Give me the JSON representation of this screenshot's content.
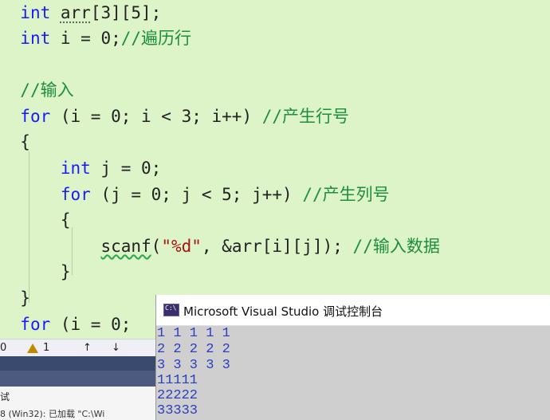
{
  "editor": {
    "lines": [
      {
        "indent": "  ",
        "parts": [
          {
            "t": "int",
            "c": "kw"
          },
          {
            "t": " ",
            "c": "id"
          },
          {
            "t": "arr",
            "c": "var dotted"
          },
          {
            "t": "[3][5];",
            "c": "id"
          }
        ]
      },
      {
        "indent": "  ",
        "parts": [
          {
            "t": "int",
            "c": "kw"
          },
          {
            "t": " i = 0;",
            "c": "id"
          },
          {
            "t": "//遍历行",
            "c": "cm"
          }
        ]
      },
      {
        "indent": "",
        "parts": []
      },
      {
        "indent": "  ",
        "parts": [
          {
            "t": "//输入",
            "c": "cm"
          }
        ]
      },
      {
        "indent": "  ",
        "parts": [
          {
            "t": "for",
            "c": "kw"
          },
          {
            "t": " (i = 0; i < 3; i++) ",
            "c": "id"
          },
          {
            "t": "//产生行号",
            "c": "cm"
          }
        ]
      },
      {
        "indent": "  ",
        "parts": [
          {
            "t": "{",
            "c": "id"
          }
        ]
      },
      {
        "indent": "      ",
        "parts": [
          {
            "t": "int",
            "c": "kw"
          },
          {
            "t": " j = 0;",
            "c": "id"
          }
        ]
      },
      {
        "indent": "      ",
        "parts": [
          {
            "t": "for",
            "c": "kw"
          },
          {
            "t": " (j = 0; j < 5; j++) ",
            "c": "id"
          },
          {
            "t": "//产生列号",
            "c": "cm"
          }
        ]
      },
      {
        "indent": "      ",
        "parts": [
          {
            "t": "{",
            "c": "id"
          }
        ]
      },
      {
        "indent": "          ",
        "parts": [
          {
            "t": "scanf",
            "c": "fn"
          },
          {
            "t": "(",
            "c": "id"
          },
          {
            "t": "\"%d\"",
            "c": "str"
          },
          {
            "t": ", &arr[i][j]); ",
            "c": "id"
          },
          {
            "t": "//输入数据",
            "c": "cm"
          }
        ]
      },
      {
        "indent": "      ",
        "parts": [
          {
            "t": "}",
            "c": "id"
          }
        ]
      },
      {
        "indent": "  ",
        "parts": [
          {
            "t": "}",
            "c": "id"
          }
        ]
      },
      {
        "indent": "  ",
        "parts": [
          {
            "t": "for",
            "c": "kw"
          },
          {
            "t": " (i = 0;",
            "c": "id"
          }
        ]
      }
    ]
  },
  "statusbar": {
    "errors": "0",
    "warnings": "1",
    "up_arrow": "↑",
    "down_arrow": "↓"
  },
  "output_panel": {
    "tab_label": "试",
    "log_text": "8 (Win32): 已加载 \"C:\\Wi"
  },
  "console": {
    "title": "Microsoft Visual Studio 调试控制台",
    "lines": [
      "1 1 1 1 1",
      "2 2 2 2 2",
      "3 3 3 3 3",
      "11111",
      "22222",
      "33333"
    ]
  },
  "colors": {
    "editor_bg": "#dcf4c8",
    "keyword": "#1a1aff",
    "comment": "#1e8e3e",
    "console_text": "#2a3fbf"
  }
}
